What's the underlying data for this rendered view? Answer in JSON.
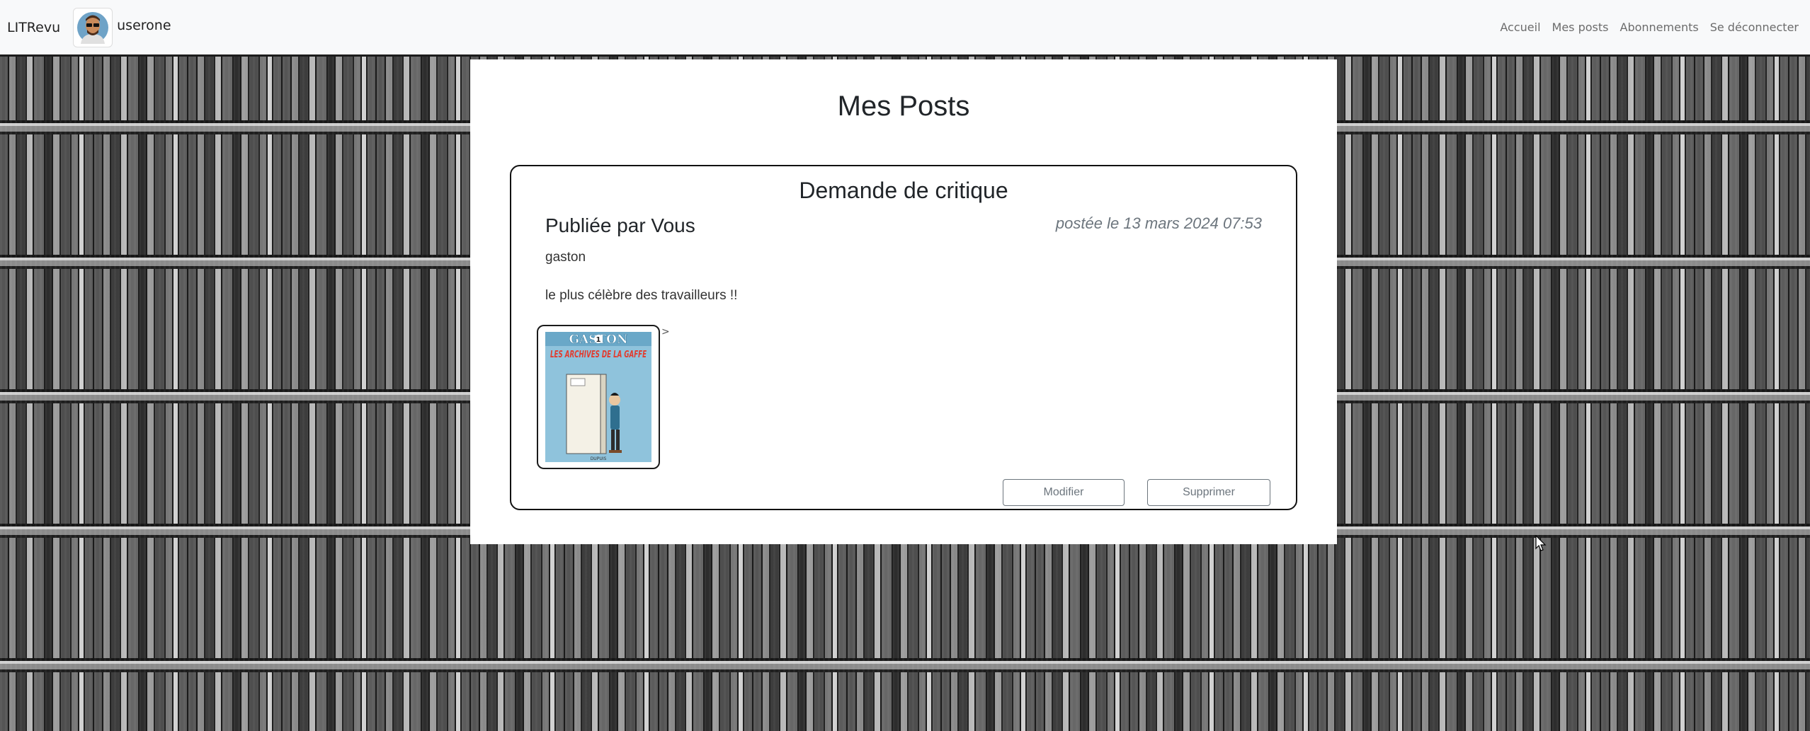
{
  "navbar": {
    "brand": "LITRevu",
    "username": "userone",
    "links": [
      "Accueil",
      "Mes posts",
      "Abonnements",
      "Se déconnecter"
    ]
  },
  "page": {
    "title": "Mes Posts"
  },
  "post": {
    "type_label": "Demande de critique",
    "author": "Publiée par Vous",
    "date": "postée le 13 mars 2024 07:53",
    "ticket_title": "gaston",
    "description": "le plus célèbre des travailleurs !!",
    "image": {
      "series": "GASTON",
      "number": "1",
      "subtitle": "LES ARCHIVES DE LA GAFFE",
      "publisher": "DUPUIS"
    },
    "stray_text": ">",
    "edit_label": "Modifier",
    "delete_label": "Supprimer"
  },
  "colors": {
    "navbar_bg": "#f8f9fa",
    "nav_link": "#6c6c6c",
    "button_text": "#6c757d",
    "card_border": "#111111"
  }
}
